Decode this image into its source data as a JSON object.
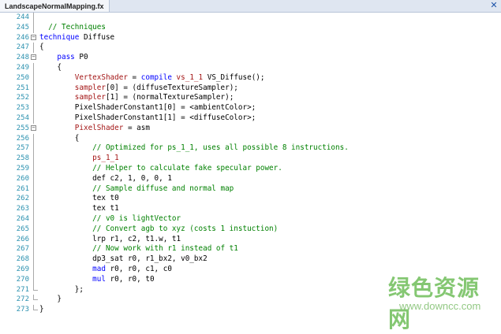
{
  "tab": {
    "title": "LandscapeNormalMapping.fx",
    "close_icon": "close-icon"
  },
  "lines": [
    {
      "num": "244",
      "fold": "line",
      "seg": []
    },
    {
      "num": "245",
      "fold": "line",
      "seg": [
        [
          "",
          "  "
        ],
        [
          "c",
          "// Techniques"
        ]
      ]
    },
    {
      "num": "246",
      "fold": "open",
      "seg": [
        [
          "k",
          "technique"
        ],
        [
          "",
          " Diffuse"
        ]
      ]
    },
    {
      "num": "247",
      "fold": "line",
      "seg": [
        [
          "",
          "{"
        ]
      ]
    },
    {
      "num": "248",
      "fold": "open",
      "seg": [
        [
          "",
          "    "
        ],
        [
          "k",
          "pass"
        ],
        [
          "",
          " P0"
        ]
      ]
    },
    {
      "num": "249",
      "fold": "line",
      "seg": [
        [
          "",
          "    {"
        ]
      ]
    },
    {
      "num": "250",
      "fold": "line",
      "seg": [
        [
          "",
          "        "
        ],
        [
          "r",
          "VertexShader"
        ],
        [
          "",
          " = "
        ],
        [
          "k",
          "compile"
        ],
        [
          "",
          " "
        ],
        [
          "r",
          "vs_1_1"
        ],
        [
          "",
          " VS_Diffuse();"
        ]
      ]
    },
    {
      "num": "251",
      "fold": "line",
      "seg": [
        [
          "",
          "        "
        ],
        [
          "r",
          "sampler"
        ],
        [
          "",
          "[0] = (diffuseTextureSampler);"
        ]
      ]
    },
    {
      "num": "252",
      "fold": "line",
      "seg": [
        [
          "",
          "        "
        ],
        [
          "r",
          "sampler"
        ],
        [
          "",
          "[1] = (normalTextureSampler);"
        ]
      ]
    },
    {
      "num": "253",
      "fold": "line",
      "seg": [
        [
          "",
          "        PixelShaderConstant1[0] = <ambientColor>;"
        ]
      ]
    },
    {
      "num": "254",
      "fold": "line",
      "seg": [
        [
          "",
          "        PixelShaderConstant1[1] = <diffuseColor>;"
        ]
      ]
    },
    {
      "num": "255",
      "fold": "open",
      "seg": [
        [
          "",
          "        "
        ],
        [
          "r",
          "PixelShader"
        ],
        [
          "",
          " = asm"
        ]
      ]
    },
    {
      "num": "256",
      "fold": "line",
      "seg": [
        [
          "",
          "        {"
        ]
      ]
    },
    {
      "num": "257",
      "fold": "line",
      "seg": [
        [
          "",
          "            "
        ],
        [
          "c",
          "// Optimized for ps_1_1, uses all possible 8 instructions."
        ]
      ]
    },
    {
      "num": "258",
      "fold": "line",
      "seg": [
        [
          "",
          "            "
        ],
        [
          "r",
          "ps_1_1"
        ]
      ]
    },
    {
      "num": "259",
      "fold": "line",
      "seg": [
        [
          "",
          "            "
        ],
        [
          "c",
          "// Helper to calculate fake specular power."
        ]
      ]
    },
    {
      "num": "260",
      "fold": "line",
      "seg": [
        [
          "",
          "            def c2, 1, 0, 0, 1"
        ]
      ]
    },
    {
      "num": "261",
      "fold": "line",
      "seg": [
        [
          "",
          "            "
        ],
        [
          "c",
          "// Sample diffuse and normal map"
        ]
      ]
    },
    {
      "num": "262",
      "fold": "line",
      "seg": [
        [
          "",
          "            tex t0"
        ]
      ]
    },
    {
      "num": "263",
      "fold": "line",
      "seg": [
        [
          "",
          "            tex t1"
        ]
      ]
    },
    {
      "num": "264",
      "fold": "line",
      "seg": [
        [
          "",
          "            "
        ],
        [
          "c",
          "// v0 is lightVector"
        ]
      ]
    },
    {
      "num": "265",
      "fold": "line",
      "seg": [
        [
          "",
          "            "
        ],
        [
          "c",
          "// Convert agb to xyz (costs 1 instuction)"
        ]
      ]
    },
    {
      "num": "266",
      "fold": "line",
      "seg": [
        [
          "",
          "            lrp r1, c2, t1.w, t1"
        ]
      ]
    },
    {
      "num": "267",
      "fold": "line",
      "seg": [
        [
          "",
          "            "
        ],
        [
          "c",
          "// Now work with r1 instead of t1"
        ]
      ]
    },
    {
      "num": "268",
      "fold": "line",
      "seg": [
        [
          "",
          "            dp3_sat r0, r1_bx2, v0_bx2"
        ]
      ]
    },
    {
      "num": "269",
      "fold": "line",
      "seg": [
        [
          "",
          "            "
        ],
        [
          "k",
          "mad"
        ],
        [
          "",
          " r0, r0, c1, c0"
        ]
      ]
    },
    {
      "num": "270",
      "fold": "line",
      "seg": [
        [
          "",
          "            "
        ],
        [
          "k",
          "mul"
        ],
        [
          "",
          " r0, r0, t0"
        ]
      ]
    },
    {
      "num": "271",
      "fold": "end",
      "seg": [
        [
          "",
          "        };"
        ]
      ]
    },
    {
      "num": "272",
      "fold": "end",
      "seg": [
        [
          "",
          "    }"
        ]
      ]
    },
    {
      "num": "273",
      "fold": "end",
      "seg": [
        [
          "",
          "}"
        ]
      ]
    }
  ],
  "watermark": {
    "logo": "绿色资源网",
    "url": "www.downcc.com"
  },
  "colors": {
    "comment": "#008000",
    "keyword": "#0000ff",
    "semantic": "#a31515",
    "line_number": "#2b91af"
  }
}
